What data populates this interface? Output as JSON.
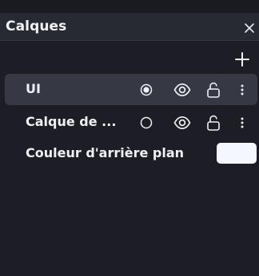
{
  "panel": {
    "title": "Calques"
  },
  "layers": [
    {
      "name": "UI",
      "selected": true,
      "active": true
    },
    {
      "name": "Calque de ...",
      "selected": false,
      "active": false
    }
  ],
  "background": {
    "label": "Couleur d'arrière plan",
    "color": "#f5f7ff"
  },
  "icons": {
    "close": "close-icon",
    "add": "plus-icon",
    "radio_on": "radio-checked-icon",
    "radio_off": "radio-unchecked-icon",
    "visibility": "eye-icon",
    "lock": "unlock-icon",
    "menu": "more-vertical-icon"
  },
  "colors": {
    "background": "#1d1e25",
    "header": "#282a33",
    "selected_row": "#363944",
    "text": "#eef0f5",
    "icon": "#e6e8ee"
  }
}
